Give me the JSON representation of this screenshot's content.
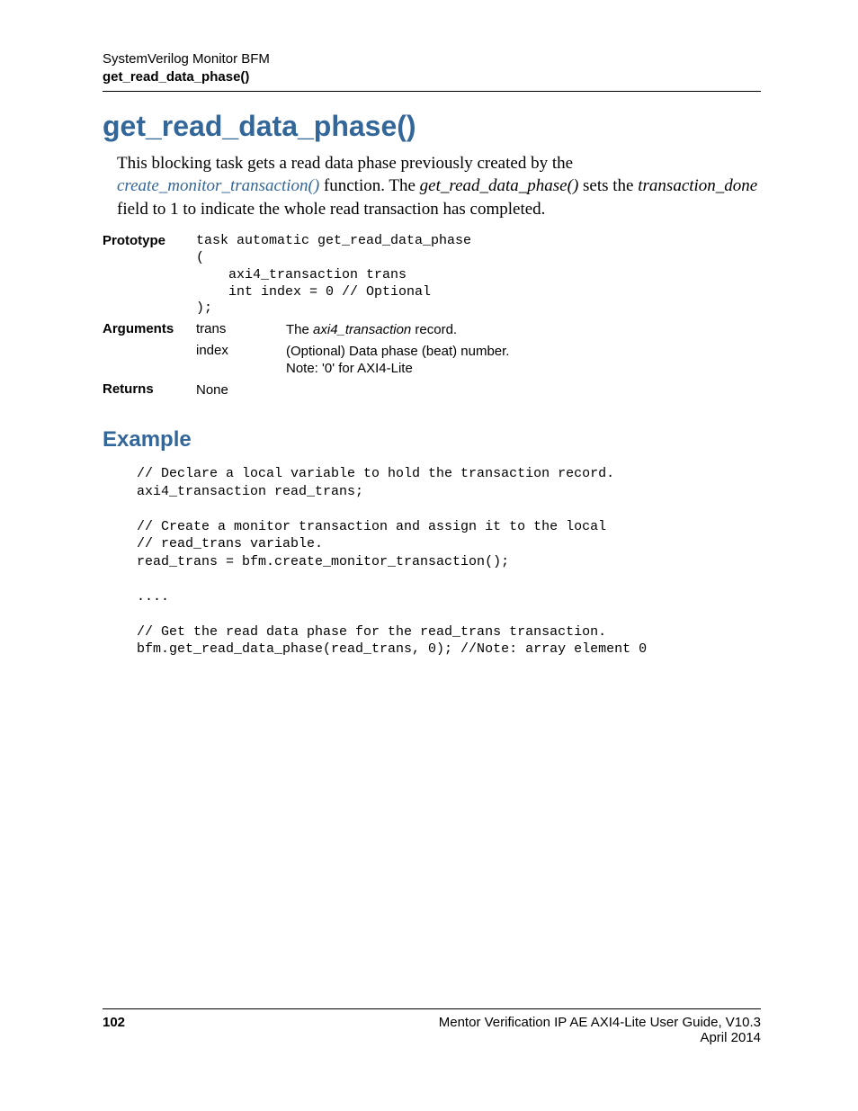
{
  "header": {
    "chapter": "SystemVerilog Monitor BFM",
    "section": "get_read_data_phase()"
  },
  "title": "get_read_data_phase()",
  "intro": {
    "p1_pre": "This blocking task gets a read data phase previously created by the ",
    "link": "create_monitor_transaction()",
    "p1_mid": " function.   The ",
    "ital1": "get_read_data_phase()",
    "p1_mid2": " sets the ",
    "ital2": "transaction_done",
    "p1_post": " field to 1 to indicate the whole read transaction has completed."
  },
  "prototype": {
    "label": "Prototype",
    "code": "task automatic get_read_data_phase\n(\n    axi4_transaction trans\n    int index = 0 // Optional\n);"
  },
  "arguments": {
    "label": "Arguments",
    "rows": [
      {
        "name": "trans",
        "desc_pre": "The ",
        "desc_ital": "axi4_transaction",
        "desc_post": " record."
      },
      {
        "name": "index",
        "desc_line1": "(Optional) Data phase (beat) number.",
        "desc_line2": "Note: '0' for AXI4-Lite"
      }
    ]
  },
  "returns": {
    "label": "Returns",
    "value": "None"
  },
  "example": {
    "heading": "Example",
    "code": "// Declare a local variable to hold the transaction record.\naxi4_transaction read_trans;\n\n// Create a monitor transaction and assign it to the local\n// read_trans variable.\nread_trans = bfm.create_monitor_transaction();\n\n....\n\n// Get the read data phase for the read_trans transaction.\nbfm.get_read_data_phase(read_trans, 0); //Note: array element 0"
  },
  "footer": {
    "page": "102",
    "guide": "Mentor Verification IP AE AXI4-Lite User Guide, V10.3",
    "date": "April 2014"
  }
}
